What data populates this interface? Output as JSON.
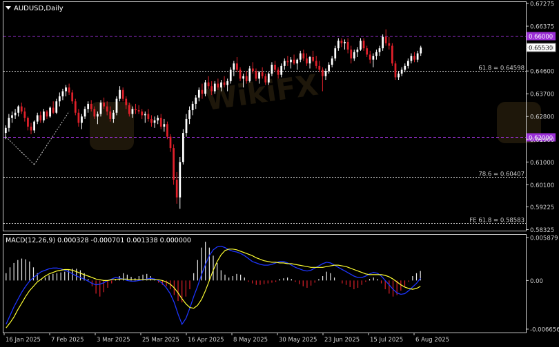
{
  "chart_data": {
    "type": "candlestick",
    "title": "AUDUSD,Daily",
    "price_axis": {
      "range": [
        0.5842,
        0.67275
      ],
      "ticks": [
        "0.67275",
        "0.66375",
        "0.65530",
        "0.64600",
        "0.63700",
        "0.62800",
        "0.61900",
        "0.61000",
        "0.60100",
        "0.59225",
        "0.58325"
      ]
    },
    "x_axis": {
      "labels": [
        "16 Jan 2025",
        "7 Feb 2025",
        "3 Mar 2025",
        "25 Mar 2025",
        "16 Apr 2025",
        "8 May 2025",
        "30 May 2025",
        "23 Jun 2025",
        "15 Jul 2025",
        "6 Aug 2025"
      ]
    },
    "horizontal_levels": [
      {
        "price": 0.66,
        "tag": "0.66000",
        "style": "dashed",
        "color": "#9b2fd6",
        "tagged": true
      },
      {
        "price": 0.62,
        "tag": "0.62000",
        "style": "dashed",
        "color": "#9b2fd6",
        "tagged": true
      },
      {
        "price": 0.64598,
        "label": "61.8 = 0.64598",
        "style": "dotted",
        "color": "#c8c8c8"
      },
      {
        "price": 0.60407,
        "label": "78.6 = 0.60407",
        "style": "dotted",
        "color": "#c8c8c8"
      },
      {
        "price": 0.58583,
        "label": "FE 61.8 = 0.58583",
        "style": "dotted",
        "color": "#c8c8c8"
      }
    ],
    "current_price": "0.65530",
    "fib_anchor_lines": [
      {
        "from": [
          0.62,
          0
        ],
        "to": [
          0.609,
          9
        ]
      },
      {
        "from": [
          0.609,
          9
        ],
        "to": [
          0.63,
          20
        ]
      }
    ],
    "candles_ohlc": [
      [
        0.6215,
        0.6245,
        0.619,
        0.6235
      ],
      [
        0.6235,
        0.629,
        0.622,
        0.6275
      ],
      [
        0.6275,
        0.63,
        0.6255,
        0.6285
      ],
      [
        0.6285,
        0.631,
        0.627,
        0.6295
      ],
      [
        0.6295,
        0.6325,
        0.628,
        0.632
      ],
      [
        0.632,
        0.6335,
        0.629,
        0.63
      ],
      [
        0.63,
        0.6315,
        0.626,
        0.6275
      ],
      [
        0.6275,
        0.628,
        0.6225,
        0.624
      ],
      [
        0.624,
        0.6255,
        0.621,
        0.6225
      ],
      [
        0.6225,
        0.6265,
        0.6215,
        0.626
      ],
      [
        0.626,
        0.6295,
        0.625,
        0.6285
      ],
      [
        0.6285,
        0.63,
        0.6255,
        0.6265
      ],
      [
        0.6265,
        0.631,
        0.6255,
        0.63
      ],
      [
        0.63,
        0.6305,
        0.627,
        0.628
      ],
      [
        0.628,
        0.632,
        0.6275,
        0.6315
      ],
      [
        0.6315,
        0.634,
        0.629,
        0.6295
      ],
      [
        0.6295,
        0.635,
        0.629,
        0.634
      ],
      [
        0.634,
        0.6375,
        0.632,
        0.636
      ],
      [
        0.636,
        0.639,
        0.6345,
        0.638
      ],
      [
        0.638,
        0.6405,
        0.636,
        0.6395
      ],
      [
        0.6395,
        0.641,
        0.6365,
        0.6375
      ],
      [
        0.6375,
        0.6385,
        0.633,
        0.634
      ],
      [
        0.634,
        0.635,
        0.6285,
        0.6295
      ],
      [
        0.6295,
        0.631,
        0.624,
        0.6255
      ],
      [
        0.6255,
        0.629,
        0.623,
        0.628
      ],
      [
        0.628,
        0.632,
        0.627,
        0.631
      ],
      [
        0.631,
        0.634,
        0.6295,
        0.633
      ],
      [
        0.633,
        0.6345,
        0.63,
        0.631
      ],
      [
        0.631,
        0.632,
        0.627,
        0.628
      ],
      [
        0.628,
        0.63,
        0.625,
        0.629
      ],
      [
        0.629,
        0.6345,
        0.628,
        0.6335
      ],
      [
        0.6335,
        0.6355,
        0.631,
        0.632
      ],
      [
        0.632,
        0.634,
        0.6285,
        0.63
      ],
      [
        0.63,
        0.632,
        0.626,
        0.627
      ],
      [
        0.627,
        0.6305,
        0.6255,
        0.6295
      ],
      [
        0.6295,
        0.636,
        0.6285,
        0.635
      ],
      [
        0.635,
        0.64,
        0.634,
        0.6385
      ],
      [
        0.6385,
        0.6395,
        0.634,
        0.635
      ],
      [
        0.635,
        0.636,
        0.631,
        0.6325
      ],
      [
        0.6325,
        0.6335,
        0.628,
        0.629
      ],
      [
        0.629,
        0.632,
        0.6275,
        0.631
      ],
      [
        0.631,
        0.633,
        0.629,
        0.6305
      ],
      [
        0.6305,
        0.6325,
        0.629,
        0.63
      ],
      [
        0.63,
        0.631,
        0.627,
        0.6285
      ],
      [
        0.6285,
        0.63,
        0.6255,
        0.629
      ],
      [
        0.629,
        0.631,
        0.626,
        0.627
      ],
      [
        0.627,
        0.6285,
        0.624,
        0.6255
      ],
      [
        0.6255,
        0.628,
        0.6235,
        0.6265
      ],
      [
        0.6265,
        0.6285,
        0.625,
        0.6275
      ],
      [
        0.6275,
        0.629,
        0.623,
        0.624
      ],
      [
        0.624,
        0.627,
        0.622,
        0.625
      ],
      [
        0.625,
        0.626,
        0.619,
        0.62
      ],
      [
        0.62,
        0.621,
        0.614,
        0.6155
      ],
      [
        0.6155,
        0.617,
        0.601,
        0.603
      ],
      [
        0.603,
        0.606,
        0.5935,
        0.596
      ],
      [
        0.596,
        0.612,
        0.5915,
        0.61
      ],
      [
        0.61,
        0.623,
        0.609,
        0.6215
      ],
      [
        0.6215,
        0.629,
        0.62,
        0.627
      ],
      [
        0.627,
        0.632,
        0.625,
        0.6305
      ],
      [
        0.6305,
        0.634,
        0.6285,
        0.633
      ],
      [
        0.633,
        0.6365,
        0.631,
        0.6355
      ],
      [
        0.6355,
        0.6395,
        0.634,
        0.6385
      ],
      [
        0.6385,
        0.641,
        0.635,
        0.637
      ],
      [
        0.637,
        0.6425,
        0.636,
        0.6415
      ],
      [
        0.6415,
        0.644,
        0.639,
        0.64
      ],
      [
        0.64,
        0.642,
        0.6365,
        0.638
      ],
      [
        0.638,
        0.642,
        0.637,
        0.641
      ],
      [
        0.641,
        0.643,
        0.6385,
        0.6395
      ],
      [
        0.6395,
        0.6425,
        0.638,
        0.6415
      ],
      [
        0.6415,
        0.644,
        0.6395,
        0.6405
      ],
      [
        0.6405,
        0.643,
        0.638,
        0.642
      ],
      [
        0.642,
        0.6475,
        0.641,
        0.6465
      ],
      [
        0.6465,
        0.65,
        0.644,
        0.649
      ],
      [
        0.649,
        0.6515,
        0.6455,
        0.6465
      ],
      [
        0.6465,
        0.6475,
        0.642,
        0.643
      ],
      [
        0.643,
        0.645,
        0.6395,
        0.644
      ],
      [
        0.644,
        0.646,
        0.641,
        0.642
      ],
      [
        0.642,
        0.648,
        0.6415,
        0.647
      ],
      [
        0.647,
        0.6495,
        0.645,
        0.646
      ],
      [
        0.646,
        0.647,
        0.642,
        0.643
      ],
      [
        0.643,
        0.646,
        0.641,
        0.6455
      ],
      [
        0.6455,
        0.6475,
        0.643,
        0.644
      ],
      [
        0.644,
        0.645,
        0.6405,
        0.6415
      ],
      [
        0.6415,
        0.6455,
        0.6405,
        0.645
      ],
      [
        0.645,
        0.6495,
        0.644,
        0.6485
      ],
      [
        0.6485,
        0.65,
        0.6455,
        0.6465
      ],
      [
        0.6465,
        0.6475,
        0.643,
        0.6445
      ],
      [
        0.6445,
        0.649,
        0.6435,
        0.648
      ],
      [
        0.648,
        0.651,
        0.6465,
        0.65
      ],
      [
        0.65,
        0.652,
        0.648,
        0.6495
      ],
      [
        0.6495,
        0.6515,
        0.647,
        0.6505
      ],
      [
        0.6505,
        0.6525,
        0.6485,
        0.649
      ],
      [
        0.649,
        0.651,
        0.6465,
        0.6505
      ],
      [
        0.6505,
        0.654,
        0.6495,
        0.653
      ],
      [
        0.653,
        0.6545,
        0.65,
        0.651
      ],
      [
        0.651,
        0.653,
        0.648,
        0.649
      ],
      [
        0.649,
        0.652,
        0.647,
        0.6515
      ],
      [
        0.6515,
        0.654,
        0.6495,
        0.65
      ],
      [
        0.65,
        0.652,
        0.647,
        0.648
      ],
      [
        0.648,
        0.65,
        0.6455,
        0.6465
      ],
      [
        0.6465,
        0.6475,
        0.638,
        0.644
      ],
      [
        0.644,
        0.647,
        0.6425,
        0.646
      ],
      [
        0.646,
        0.6495,
        0.645,
        0.6485
      ],
      [
        0.6485,
        0.652,
        0.6475,
        0.651
      ],
      [
        0.651,
        0.656,
        0.65,
        0.655
      ],
      [
        0.655,
        0.659,
        0.654,
        0.658
      ],
      [
        0.658,
        0.659,
        0.6555,
        0.657
      ],
      [
        0.657,
        0.6585,
        0.6545,
        0.6575
      ],
      [
        0.6575,
        0.659,
        0.653,
        0.6545
      ],
      [
        0.6545,
        0.656,
        0.649,
        0.651
      ],
      [
        0.651,
        0.6545,
        0.65,
        0.6535
      ],
      [
        0.6535,
        0.6555,
        0.6515,
        0.6545
      ],
      [
        0.6545,
        0.659,
        0.654,
        0.658
      ],
      [
        0.658,
        0.659,
        0.654,
        0.655
      ],
      [
        0.655,
        0.656,
        0.6515,
        0.6525
      ],
      [
        0.6525,
        0.654,
        0.649,
        0.6505
      ],
      [
        0.6505,
        0.653,
        0.6475,
        0.652
      ],
      [
        0.652,
        0.6545,
        0.6505,
        0.6535
      ],
      [
        0.6535,
        0.656,
        0.652,
        0.655
      ],
      [
        0.655,
        0.6605,
        0.654,
        0.6595
      ],
      [
        0.6595,
        0.6625,
        0.656,
        0.657
      ],
      [
        0.657,
        0.6595,
        0.6545,
        0.656
      ],
      [
        0.656,
        0.657,
        0.648,
        0.649
      ],
      [
        0.649,
        0.65,
        0.6425,
        0.6435
      ],
      [
        0.6435,
        0.646,
        0.6425,
        0.645
      ],
      [
        0.645,
        0.6475,
        0.644,
        0.6465
      ],
      [
        0.6465,
        0.649,
        0.6455,
        0.648
      ],
      [
        0.648,
        0.651,
        0.647,
        0.65
      ],
      [
        0.65,
        0.653,
        0.649,
        0.652
      ],
      [
        0.652,
        0.6535,
        0.6495,
        0.6505
      ],
      [
        0.6505,
        0.654,
        0.6495,
        0.653
      ],
      [
        0.653,
        0.656,
        0.652,
        0.6553
      ]
    ],
    "macd": {
      "label": "MACD(12,26,9) 0.000328 -0.000701 0.001338 0.000000",
      "range": [
        -0.006656,
        0.005879
      ],
      "ticks": [
        "0.005879",
        "0.00",
        "-0.006656"
      ],
      "histogram": [
        0.001,
        0.0018,
        0.0024,
        0.0028,
        0.003,
        0.0029,
        0.0026,
        0.0018,
        0.001,
        0.0002,
        0.0004,
        0.0007,
        0.0009,
        0.001,
        0.0011,
        0.0012,
        0.0014,
        0.0016,
        0.0016,
        0.0014,
        0.001,
        0.0002,
        -0.0008,
        -0.0018,
        -0.0022,
        -0.0016,
        -0.001,
        -0.0004,
        0.0002,
        0.0006,
        0.001,
        0.0008,
        0.0005,
        0.0003,
        0.0006,
        0.0008,
        0.0009,
        0.0006,
        0.0002,
        -0.0003,
        -0.0006,
        -0.0008,
        -0.0012,
        -0.002,
        -0.0028,
        -0.003,
        -0.0022,
        -0.0012,
        0.001,
        0.0028,
        0.0045,
        0.0053,
        0.0045,
        0.0034,
        0.0024,
        0.0014,
        0.0008,
        0.0004,
        0.0006,
        0.0009,
        0.0008,
        0.0004,
        -0.0002,
        -0.0004,
        -0.0006,
        -0.0006,
        -0.0005,
        -0.0004,
        -0.0003,
        -0.0002,
        0.0002,
        0.0003,
        0.0004,
        0.0002,
        -0.0002,
        -0.0005,
        -0.0008,
        -0.001,
        -0.0007,
        -0.0003,
        0.0002,
        0.0006,
        0.0012,
        0.001,
        0.0004,
        0.0,
        -0.0004,
        -0.0006,
        -0.0009,
        -0.0012,
        -0.001,
        -0.0006,
        -0.0002,
        0.0002,
        0.0004,
        0.0002,
        -0.0004,
        -0.0012,
        -0.0018,
        -0.0022,
        -0.002,
        -0.0014,
        -0.0008,
        -0.0002,
        0.0006,
        0.001,
        0.0013
      ],
      "macd_line": [
        -0.006,
        -0.0048,
        -0.0036,
        -0.0026,
        -0.0016,
        -0.0008,
        -0.0001,
        0.0004,
        0.0008,
        0.0012,
        0.0014,
        0.0016,
        0.0017,
        0.0017,
        0.0016,
        0.0014,
        0.0012,
        0.0009,
        0.0006,
        0.0004,
        0.0002,
        -0.0001,
        -0.0004,
        -0.0006,
        -0.0005,
        -0.0003,
        0.0,
        0.0002,
        0.0004,
        0.0003,
        0.0002,
        0.0,
        -0.0001,
        -0.0001,
        0.0,
        0.0001,
        0.0002,
        0.0003,
        0.0002,
        0.0,
        -0.0004,
        -0.001,
        -0.0018,
        -0.003,
        -0.0046,
        -0.006,
        -0.0052,
        -0.0038,
        -0.0022,
        -0.0008,
        0.0008,
        0.0022,
        0.0034,
        0.0042,
        0.0046,
        0.0047,
        0.0045,
        0.0042,
        0.004,
        0.0039,
        0.0037,
        0.0034,
        0.003,
        0.0026,
        0.0024,
        0.0022,
        0.0021,
        0.0021,
        0.0022,
        0.0024,
        0.0026,
        0.0026,
        0.0024,
        0.0021,
        0.0018,
        0.0016,
        0.0014,
        0.0013,
        0.0014,
        0.0017,
        0.002,
        0.0023,
        0.0025,
        0.0024,
        0.0021,
        0.0018,
        0.0015,
        0.0012,
        0.0009,
        0.0006,
        0.0004,
        0.0004,
        0.0006,
        0.0009,
        0.0011,
        0.001,
        0.0006,
        0.0,
        -0.0006,
        -0.0012,
        -0.0017,
        -0.0019,
        -0.0018,
        -0.0014,
        -0.0009,
        -0.0004,
        0.0003
      ],
      "signal_line": [
        -0.0065,
        -0.0058,
        -0.005,
        -0.004,
        -0.0031,
        -0.0022,
        -0.0014,
        -0.0008,
        -0.0002,
        0.0002,
        0.0006,
        0.0009,
        0.0011,
        0.0013,
        0.0014,
        0.0015,
        0.0015,
        0.0014,
        0.0012,
        0.001,
        0.0008,
        0.0006,
        0.0004,
        0.0002,
        0.0001,
        0.0,
        0.0,
        0.0001,
        0.0001,
        0.0002,
        0.0002,
        0.0002,
        0.0001,
        0.0001,
        0.0001,
        0.0001,
        0.0001,
        0.0001,
        0.0001,
        0.0001,
        0.0,
        -0.0002,
        -0.0005,
        -0.001,
        -0.0017,
        -0.0025,
        -0.0032,
        -0.0037,
        -0.0038,
        -0.0034,
        -0.0026,
        -0.0014,
        0.0,
        0.0014,
        0.0026,
        0.0035,
        0.0041,
        0.0043,
        0.0043,
        0.0042,
        0.004,
        0.0038,
        0.0036,
        0.0034,
        0.0031,
        0.0029,
        0.0027,
        0.0026,
        0.0025,
        0.0025,
        0.0024,
        0.0024,
        0.0023,
        0.0023,
        0.0022,
        0.0021,
        0.002,
        0.0019,
        0.0018,
        0.0018,
        0.0018,
        0.0018,
        0.0019,
        0.002,
        0.0021,
        0.0021,
        0.002,
        0.0019,
        0.0017,
        0.0015,
        0.0013,
        0.0011,
        0.0009,
        0.0008,
        0.0008,
        0.0008,
        0.0008,
        0.0007,
        0.0005,
        0.0002,
        -0.0002,
        -0.0006,
        -0.0009,
        -0.0011,
        -0.0012,
        -0.0011,
        -0.0008
      ]
    },
    "colors": {
      "background": "#000000",
      "bull_candle": "#ffffff",
      "bear_candle": "#e0202a",
      "axis": "#cfcfcf",
      "level_purple": "#9b2fd6",
      "macd_line": "#1e35ff",
      "signal_line": "#ffff33",
      "hist_pos": "#e8e8e8",
      "hist_neg": "#e0202a"
    }
  }
}
